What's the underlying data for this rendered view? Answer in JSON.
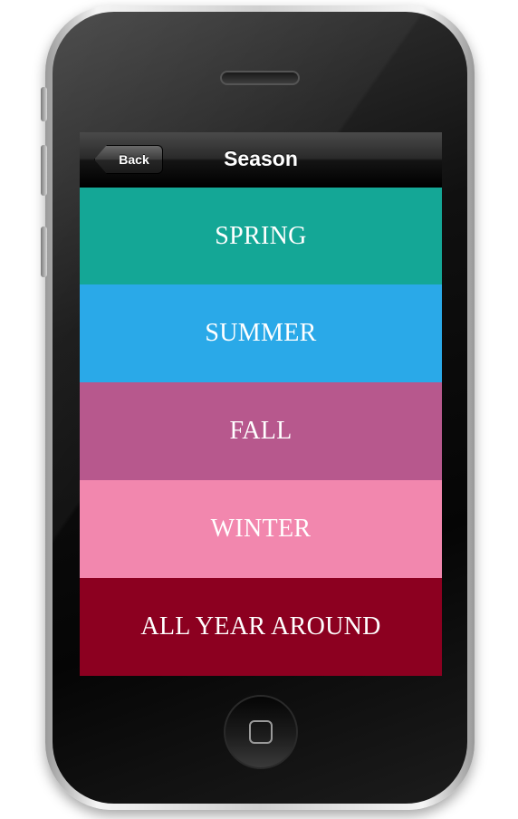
{
  "navbar": {
    "back_label": "Back",
    "title": "Season"
  },
  "seasons": [
    {
      "label": "SPRING",
      "color": "#14a796"
    },
    {
      "label": "SUMMER",
      "color": "#2aa9e8"
    },
    {
      "label": "FALL",
      "color": "#b7588d"
    },
    {
      "label": "WINTER",
      "color": "#f287ae"
    },
    {
      "label": "ALL YEAR AROUND",
      "color": "#8c0020"
    }
  ],
  "icons": {
    "home": "home-button-icon",
    "speaker": "speaker-grille",
    "back": "back-arrow-button"
  }
}
